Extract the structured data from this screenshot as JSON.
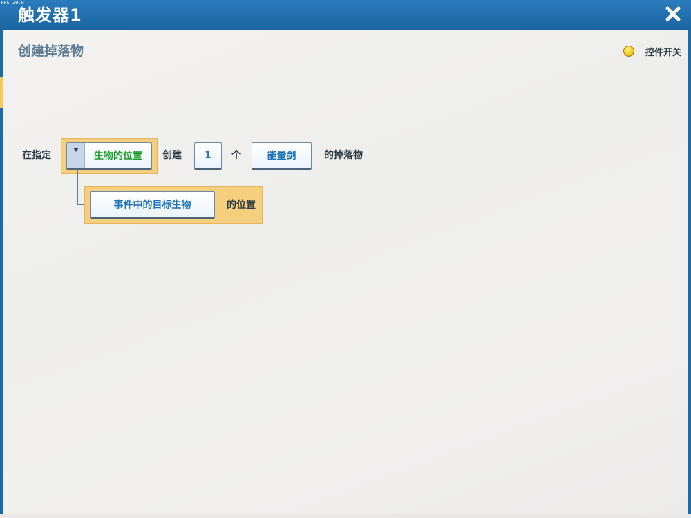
{
  "fps_text": "FPS 29.9",
  "window": {
    "title": "触发器1"
  },
  "header": {
    "title": "创建掉落物",
    "toggle_label": "控件开关"
  },
  "statement": {
    "prefix": "在指定",
    "position_option": "生物的位置",
    "create_text": "创建",
    "count_value": "1",
    "count_unit": "个",
    "item_value": "能量剑",
    "suffix": "的掉落物",
    "sub_parameter": "事件中的目标生物",
    "sub_suffix": "的位置"
  },
  "colors": {
    "titlebar": "#1b64a0",
    "slot_highlight": "#f6cf7e",
    "green_text": "#1a9e2a",
    "blue_text": "#1b72b8",
    "toggle_yellow": "#f2c81e"
  }
}
